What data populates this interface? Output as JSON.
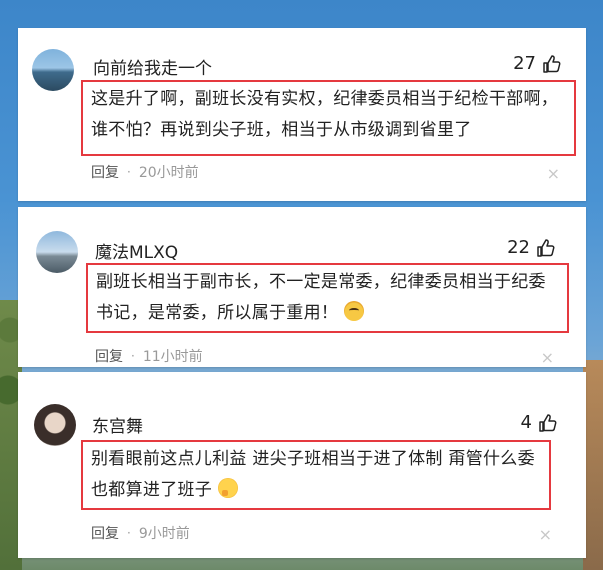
{
  "comments": [
    {
      "username": "向前给我走一个",
      "likes": "27",
      "text": "这是升了啊，副班长没有实权，纪律委员相当于纪检干部啊，谁不怕？再说到尖子班，相当于从市级调到省里了",
      "reply_label": "回复",
      "separator": "·",
      "time": "20小时前"
    },
    {
      "username": "魔法MLXQ",
      "likes": "22",
      "text": "副班长相当于副市长，不一定是常委，纪律委员相当于纪委书记，是常委，所以属于重用！",
      "reply_label": "回复",
      "separator": "·",
      "time": "11小时前"
    },
    {
      "username": "东宫舞",
      "likes": "4",
      "text": "别看眼前这点儿利益 进尖子班相当于进了体制 甭管什么委 也都算进了班子",
      "reply_label": "回复",
      "separator": "·",
      "time": "9小时前"
    }
  ],
  "icons": {
    "like": "thumbs-up-icon",
    "close": "close-icon",
    "emoji_1": "tiger-face-emoji",
    "emoji_2": "thinking-face-emoji"
  },
  "colors": {
    "highlight_border": "#e5393f",
    "text": "#222222",
    "meta": "#999999"
  },
  "close_glyph": "×"
}
